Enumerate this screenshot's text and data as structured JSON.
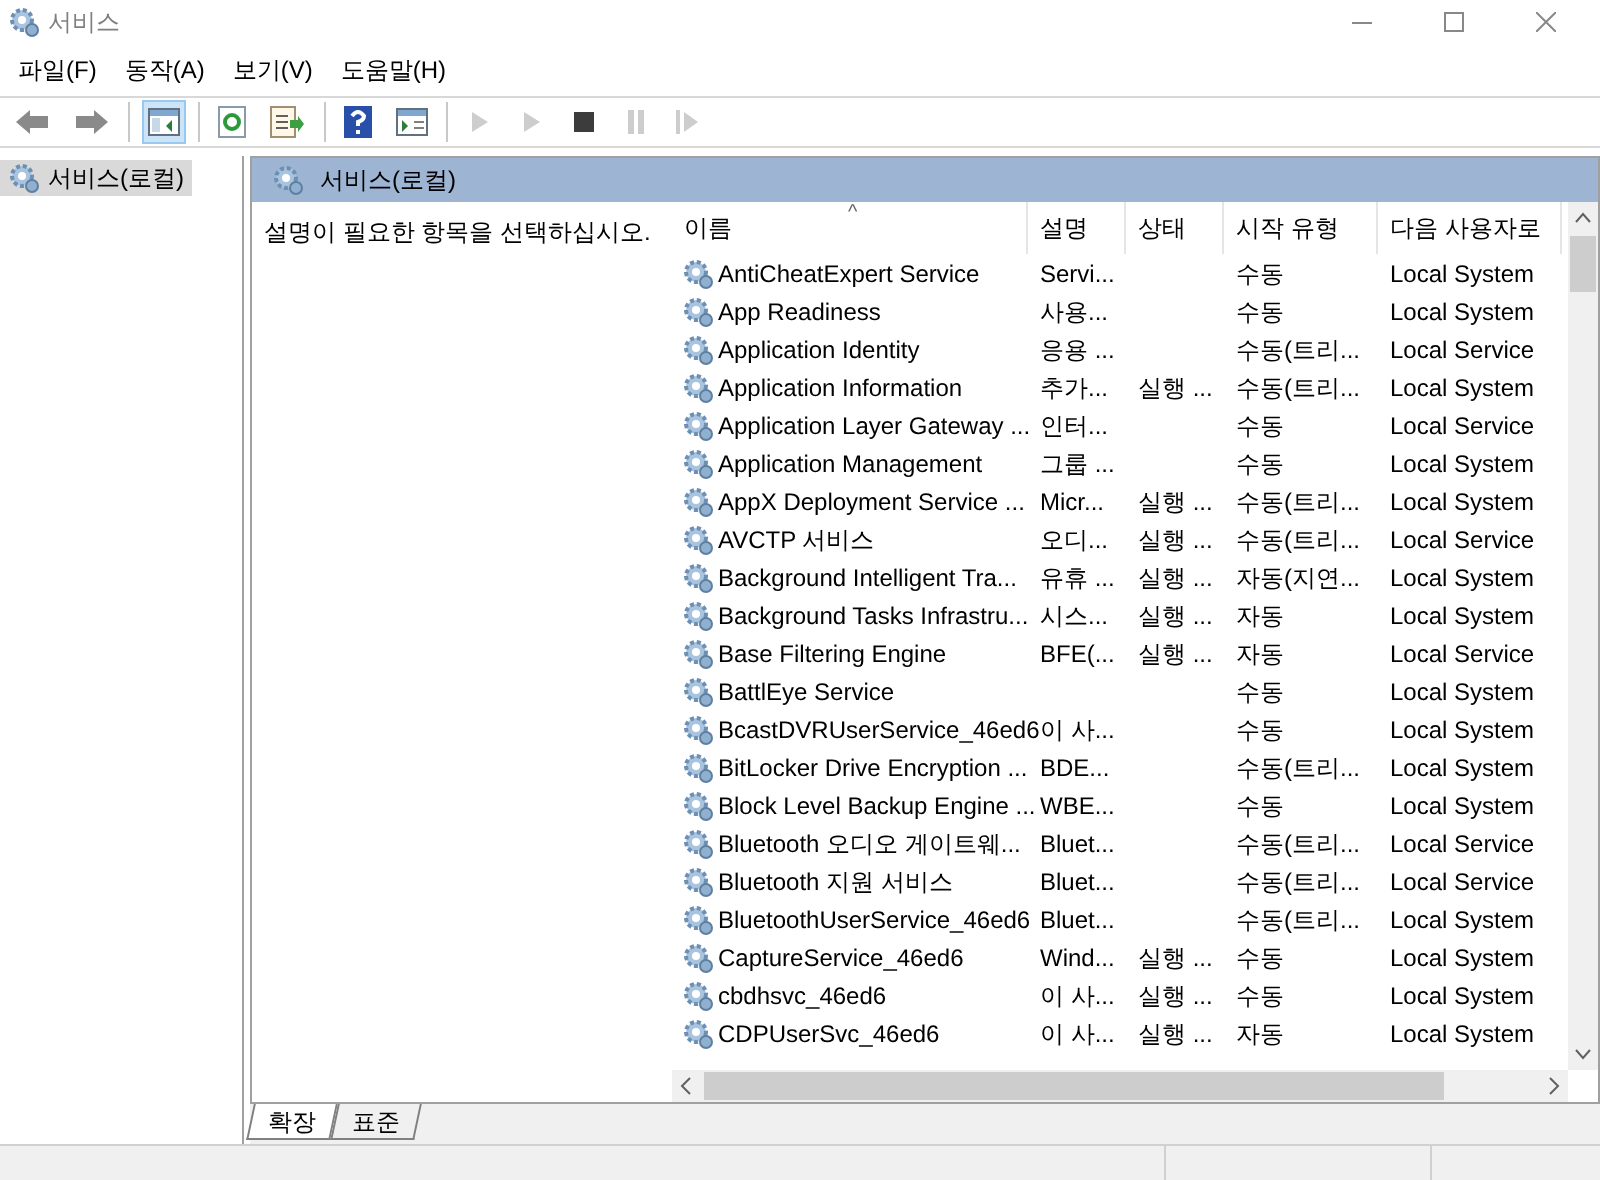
{
  "window": {
    "title": "서비스"
  },
  "menu": [
    "파일(F)",
    "동작(A)",
    "보기(V)",
    "도움말(H)"
  ],
  "toolbar": [
    {
      "kind": "back",
      "selected": false,
      "disabled": false
    },
    {
      "kind": "forward",
      "selected": false,
      "disabled": false
    },
    {
      "kind": "sep"
    },
    {
      "kind": "tree",
      "selected": true,
      "disabled": false
    },
    {
      "kind": "sep"
    },
    {
      "kind": "refresh",
      "selected": false,
      "disabled": false
    },
    {
      "kind": "export",
      "selected": false,
      "disabled": false
    },
    {
      "kind": "sep"
    },
    {
      "kind": "help",
      "selected": false,
      "disabled": false
    },
    {
      "kind": "view",
      "selected": false,
      "disabled": false
    },
    {
      "kind": "sep"
    },
    {
      "kind": "play",
      "selected": false,
      "disabled": true
    },
    {
      "kind": "play",
      "selected": false,
      "disabled": true
    },
    {
      "kind": "stop",
      "selected": false,
      "disabled": false
    },
    {
      "kind": "pause",
      "selected": false,
      "disabled": true
    },
    {
      "kind": "resume",
      "selected": false,
      "disabled": true
    }
  ],
  "tree": {
    "items": [
      {
        "label": "서비스(로컬)",
        "selected": true
      }
    ]
  },
  "panel_header": "서비스(로컬)",
  "description": "설명이 필요한 항목을 선택하십시오.",
  "table": {
    "sort_mark": "^",
    "columns": [
      "이름",
      "설명",
      "상태",
      "시작 유형",
      "다음 사용자로"
    ],
    "rows": [
      [
        "AntiCheatExpert Service",
        "Servi...",
        "",
        "수동",
        "Local System"
      ],
      [
        "App Readiness",
        "사용...",
        "",
        "수동",
        "Local System"
      ],
      [
        "Application Identity",
        "응용 ...",
        "",
        "수동(트리...",
        "Local Service"
      ],
      [
        "Application Information",
        "추가...",
        "실행 ...",
        "수동(트리...",
        "Local System"
      ],
      [
        "Application Layer Gateway ...",
        "인터...",
        "",
        "수동",
        "Local Service"
      ],
      [
        "Application Management",
        "그룹 ...",
        "",
        "수동",
        "Local System"
      ],
      [
        "AppX Deployment Service ...",
        "Micr...",
        "실행 ...",
        "수동(트리...",
        "Local System"
      ],
      [
        "AVCTP 서비스",
        "오디...",
        "실행 ...",
        "수동(트리...",
        "Local Service"
      ],
      [
        "Background Intelligent Tra...",
        "유휴 ...",
        "실행 ...",
        "자동(지연...",
        "Local System"
      ],
      [
        "Background Tasks Infrastru...",
        "시스...",
        "실행 ...",
        "자동",
        "Local System"
      ],
      [
        "Base Filtering Engine",
        "BFE(...",
        "실행 ...",
        "자동",
        "Local Service"
      ],
      [
        "BattlEye Service",
        "",
        "",
        "수동",
        "Local System"
      ],
      [
        "BcastDVRUserService_46ed6",
        "이 사...",
        "",
        "수동",
        "Local System"
      ],
      [
        "BitLocker Drive Encryption ...",
        "BDE...",
        "",
        "수동(트리...",
        "Local System"
      ],
      [
        "Block Level Backup Engine ...",
        "WBE...",
        "",
        "수동",
        "Local System"
      ],
      [
        "Bluetooth 오디오 게이트웨...",
        "Bluet...",
        "",
        "수동(트리...",
        "Local Service"
      ],
      [
        "Bluetooth 지원 서비스",
        "Bluet...",
        "",
        "수동(트리...",
        "Local Service"
      ],
      [
        "BluetoothUserService_46ed6",
        "Bluet...",
        "",
        "수동(트리...",
        "Local System"
      ],
      [
        "CaptureService_46ed6",
        "Wind...",
        "실행 ...",
        "수동",
        "Local System"
      ],
      [
        "cbdhsvc_46ed6",
        "이 사...",
        "실행 ...",
        "수동",
        "Local System"
      ],
      [
        "CDPUserSvc_46ed6",
        "이 사...",
        "실행 ...",
        "자동",
        "Local System"
      ]
    ]
  },
  "tabs": [
    {
      "label": "확장",
      "selected": true
    },
    {
      "label": "표준",
      "selected": false
    }
  ]
}
